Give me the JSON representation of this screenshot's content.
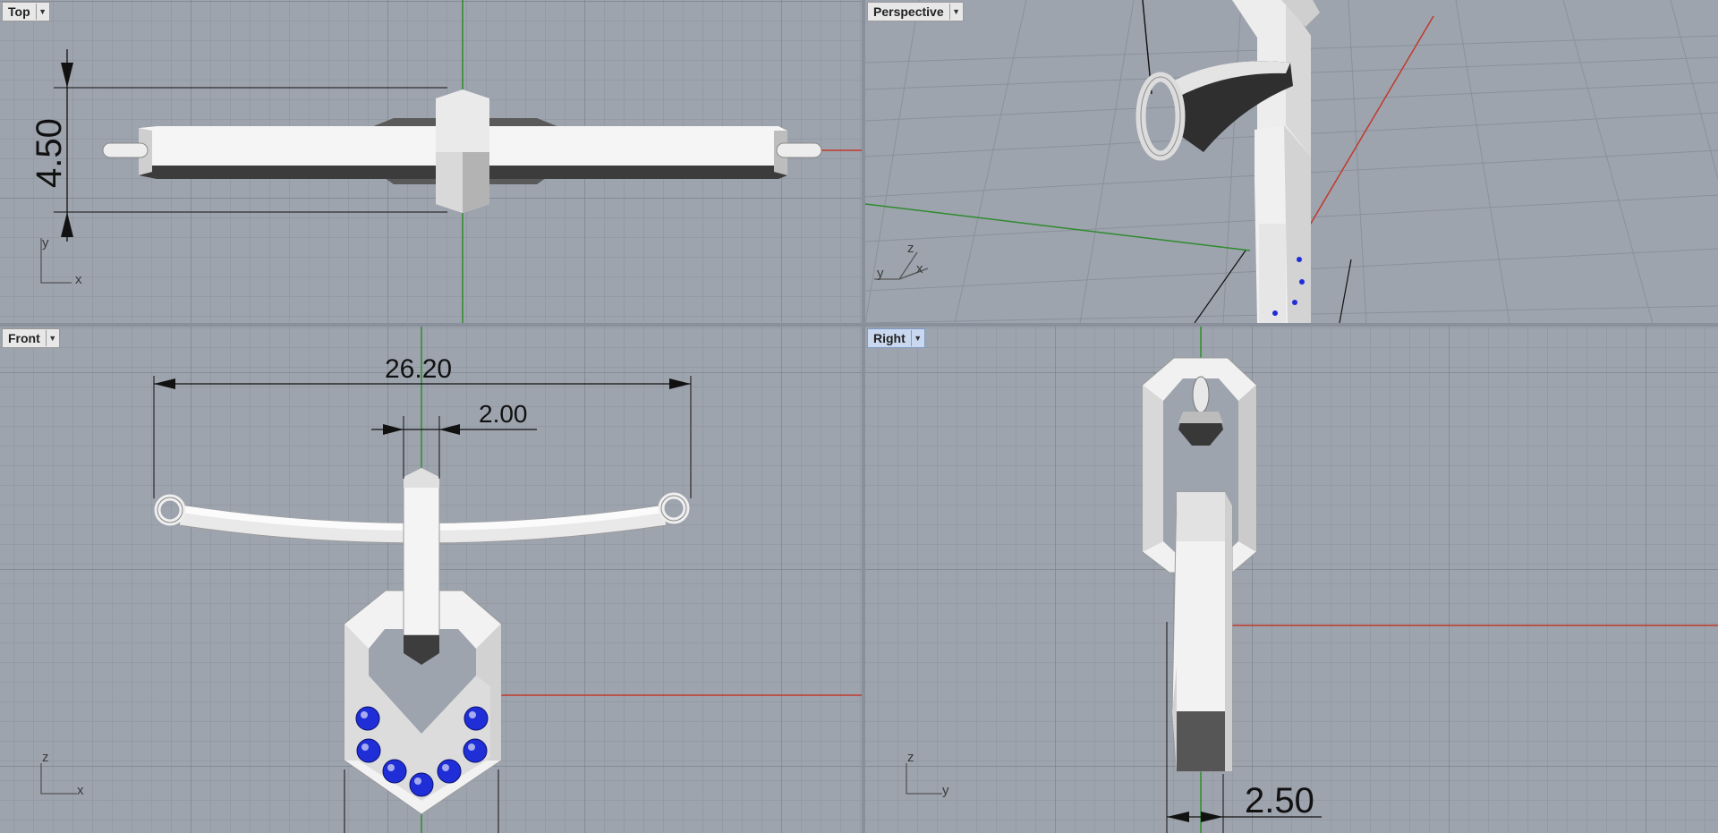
{
  "viewports": {
    "top": {
      "title": "Top",
      "dimension": "4.50",
      "axis_x": "x",
      "axis_y": "y"
    },
    "perspective": {
      "title": "Perspective",
      "axis_x": "x",
      "axis_y": "y",
      "axis_z": "z"
    },
    "front": {
      "title": "Front",
      "dimension_width": "26.20",
      "dimension_stem": "2.00",
      "axis_x": "x",
      "axis_z": "z"
    },
    "right": {
      "title": "Right",
      "dimension": "2.50",
      "axis_y": "y",
      "axis_z": "z"
    }
  },
  "colors": {
    "grid_bg": "#9ea4ae",
    "grid_line": "#8b919b",
    "grid_major": "#7c838e",
    "axis_x": "#c0392b",
    "axis_y": "#2e8b2e",
    "gem": "#1f2ed6",
    "metal_light": "#f4f4f4",
    "metal_dark": "#3d3d3d",
    "active_tab": "#c9d8ee"
  },
  "icons": {
    "viewport_menu": "chevron-down-icon"
  }
}
